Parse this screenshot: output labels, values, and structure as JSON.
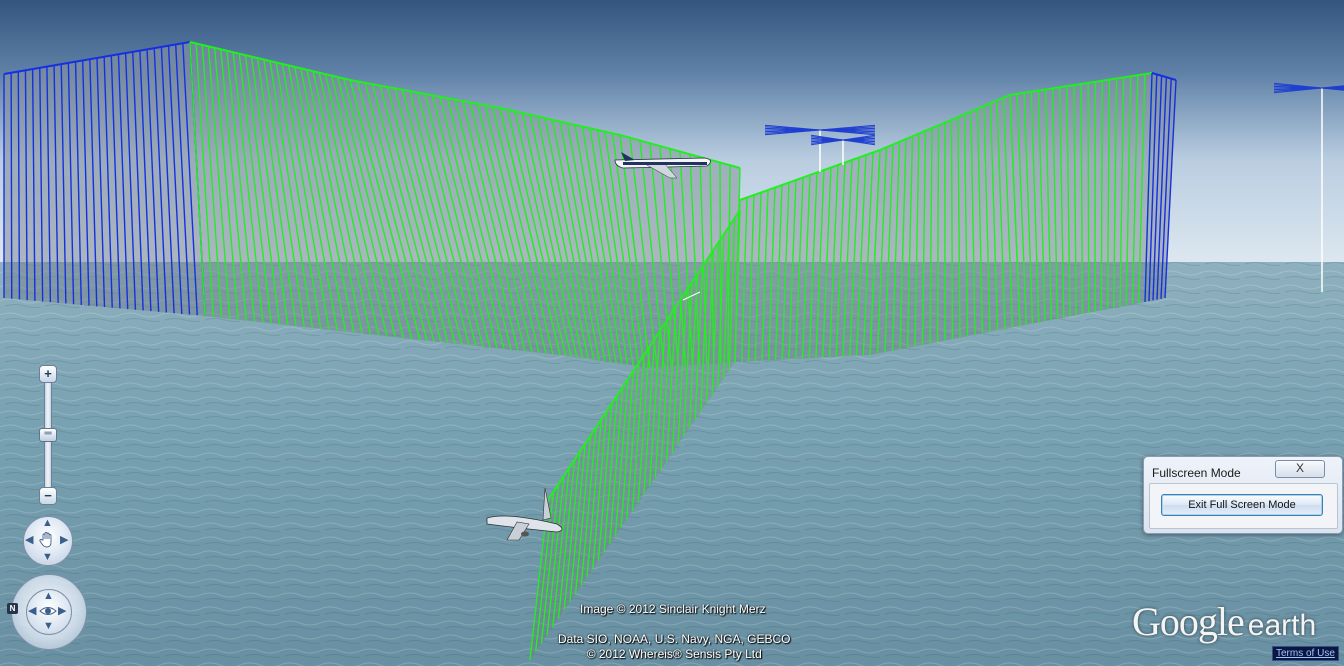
{
  "map": {
    "image_credit": "Image © 2012 Sinclair Knight Merz",
    "data_credit_line1": "Data SIO, NOAA, U.S. Navy, NGA, GEBCO",
    "data_credit_line2": "© 2012 Whereis® Sensis Pty Ltd",
    "logo_google": "Google",
    "logo_earth": "earth",
    "terms_link": "Terms of Use",
    "flight_label_near": "",
    "flight_label_far": ""
  },
  "dialog": {
    "title": "Fullscreen Mode",
    "close_label": "X",
    "exit_button_label": "Exit Full Screen Mode"
  },
  "nav": {
    "zoom_in_label": "+",
    "zoom_out_label": "−",
    "north_label": "N"
  },
  "colors": {
    "sky_top": "#3b5d88",
    "sky_horizon": "#dfe9f1",
    "ocean": "#6f98a8",
    "track_green": "#22ee22",
    "track_blue": "#1530e0",
    "curtain_fill": "#9aa7b5"
  },
  "icons": [
    "zoom-in-icon",
    "zoom-out-icon",
    "hand-pan-icon",
    "eye-look-icon",
    "north-indicator-icon",
    "close-icon",
    "airplane-icon",
    "antenna-icon"
  ]
}
